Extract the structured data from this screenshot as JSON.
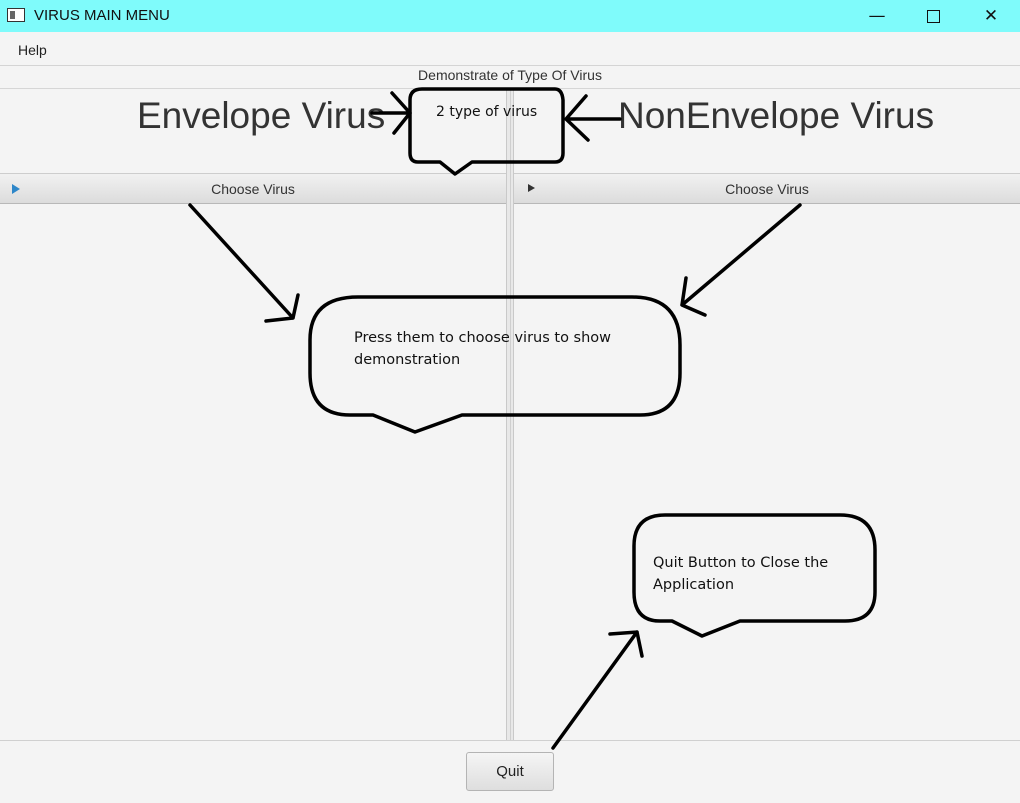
{
  "window": {
    "title": "VIRUS MAIN MENU",
    "minimize_glyph": "—",
    "close_glyph": "✕"
  },
  "menu": {
    "items": [
      {
        "label": "Help"
      }
    ]
  },
  "header": {
    "label": "Demonstrate of Type Of Virus"
  },
  "labels": {
    "envelope": "Envelope Virus",
    "nonenvelope": "NonEnvelope Virus"
  },
  "panes": {
    "left": {
      "label": "Choose Virus",
      "icon": "triangle-right-icon"
    },
    "right": {
      "label": "Choose Virus",
      "icon": "triangle-right-icon"
    }
  },
  "annotations": {
    "top": "2 type of virus",
    "middle": "Press them to choose virus to show demonstration",
    "quit": "Quit Button to Close the Application"
  },
  "footer": {
    "quit_label": "Quit"
  },
  "colors": {
    "titlebar": "#7ffbfb",
    "accent_triangle": "#2e87c9"
  }
}
